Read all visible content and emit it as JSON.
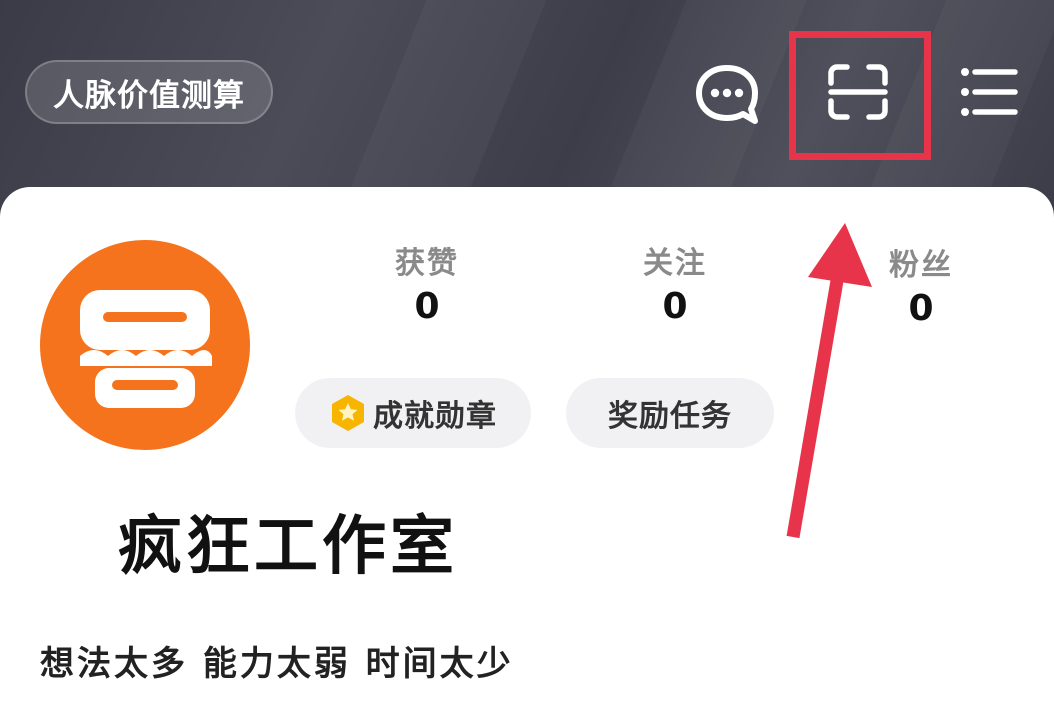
{
  "header": {
    "calc_pill_label": "人脉价值测算"
  },
  "icons": {
    "message": "chat-bubble-icon",
    "scan": "scan-icon",
    "menu": "menu-list-icon",
    "achievement": "hexagon-star-icon"
  },
  "stats": [
    {
      "label": "获赞",
      "value": "0"
    },
    {
      "label": "关注",
      "value": "0"
    },
    {
      "label": "粉丝",
      "value": "0"
    }
  ],
  "chips": {
    "achievement_label": "成就勋章",
    "reward_label": "奖励任务"
  },
  "profile": {
    "name": "疯狂工作室",
    "bio": "想法太多 能力太弱 时间太少"
  },
  "colors": {
    "header_bg": "#41414d",
    "avatar_bg": "#f5731c",
    "highlight": "#e8344a",
    "badge": "#f7b500"
  }
}
